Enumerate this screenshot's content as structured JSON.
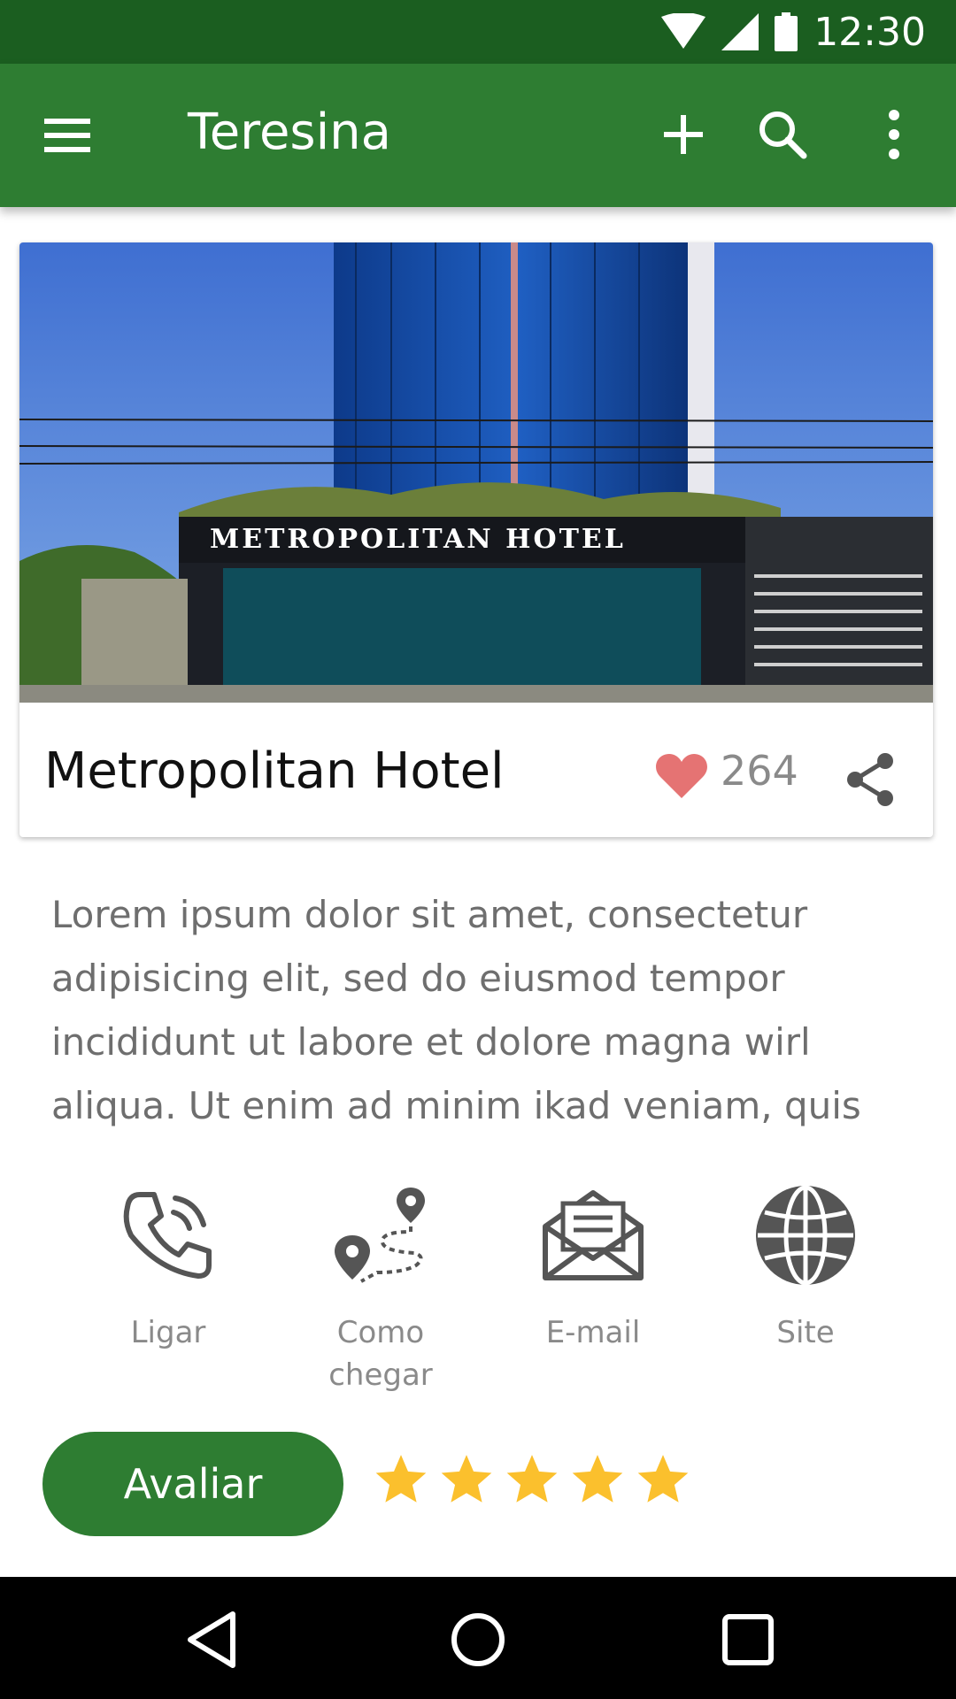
{
  "status_bar": {
    "time": "12:30",
    "icons": [
      "wifi-icon",
      "signal-icon",
      "battery-icon"
    ]
  },
  "app_bar": {
    "title": "Teresina",
    "icons": [
      "menu-icon",
      "add-icon",
      "search-icon",
      "more-vert-icon"
    ],
    "color": "#2E7D32",
    "status_color": "#1B5E20"
  },
  "place": {
    "name": "Metropolitan Hotel",
    "likes": "264",
    "photo_sign": "METROPOLITAN   HOTEL",
    "heart_color": "#E57373"
  },
  "description": "Lorem ipsum dolor sit amet, consectetur adipisicing elit, sed do eiusmod tempor incididunt ut labore et dolore magna wirl aliqua. Ut enim ad minim ikad veniam, quis",
  "actions": [
    {
      "label": "Ligar",
      "icon": "phone-icon"
    },
    {
      "label": "Como chegar",
      "icon": "route-icon"
    },
    {
      "label": "E-mail",
      "icon": "email-icon"
    },
    {
      "label": "Site",
      "icon": "globe-icon"
    }
  ],
  "rating": {
    "button_label": "Avaliar",
    "stars": 5,
    "max_stars": 5,
    "star_color": "#FBC02D"
  },
  "nav_bar": {
    "icons": [
      "back-icon",
      "home-icon",
      "recents-icon"
    ]
  }
}
